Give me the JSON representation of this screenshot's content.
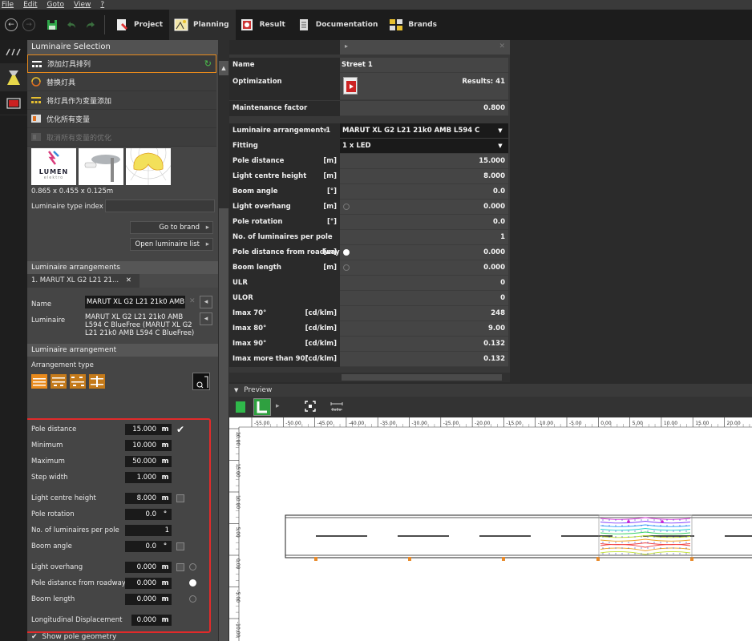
{
  "menu": [
    "File",
    "Edit",
    "Goto",
    "View",
    "?"
  ],
  "toolbar": {
    "tabs": [
      {
        "label": "Project",
        "active": false
      },
      {
        "label": "Planning",
        "active": true
      },
      {
        "label": "Result",
        "active": false
      },
      {
        "label": "Documentation",
        "active": false
      },
      {
        "label": "Brands",
        "active": false
      }
    ]
  },
  "left": {
    "selection_title": "Luminaire Selection",
    "menu_items": [
      "添加灯具排列",
      "替换灯具",
      "将灯具作为变量添加",
      "优化所有变量",
      "取消所有变量的优化"
    ],
    "brand_logo": "LUMEN",
    "brand_sub": "elektro",
    "dimensions": "0.865 x 0.455 x 0.125m",
    "type_index_label": "Luminaire type index",
    "type_index_value": "",
    "go_to_brand": "Go to brand",
    "open_list": "Open luminaire list",
    "arrangements_title": "Luminaire arrangements",
    "arrangement_tab": "1. MARUT XL G2 L21 21...",
    "name_label": "Name",
    "name_value": "MARUT XL G2 L21 21k0 AMB",
    "luminaire_label": "Luminaire",
    "luminaire_value": "MARUT XL G2 L21 21k0 AMB L594 C BlueFree (MARUT XL G2 L21 21k0 AMB L594 C BlueFree)",
    "arrangement_title": "Luminaire arrangement",
    "arrangement_type": "Arrangement type",
    "fields": {
      "pole_distance": {
        "label": "Pole distance",
        "value": "15.000",
        "unit": "m"
      },
      "minimum": {
        "label": "Minimum",
        "value": "10.000",
        "unit": "m"
      },
      "maximum": {
        "label": "Maximum",
        "value": "50.000",
        "unit": "m"
      },
      "step": {
        "label": "Step width",
        "value": "1.000",
        "unit": "m"
      },
      "lch": {
        "label": "Light centre height",
        "value": "8.000",
        "unit": "m"
      },
      "rot": {
        "label": "Pole rotation",
        "value": "0.0",
        "unit": "°"
      },
      "num": {
        "label": "No. of luminaires per pole",
        "value": "1"
      },
      "boom_angle": {
        "label": "Boom angle",
        "value": "0.0",
        "unit": "°"
      },
      "overhang": {
        "label": "Light overhang",
        "value": "0.000",
        "unit": "m"
      },
      "pdr": {
        "label": "Pole distance from roadway",
        "value": "0.000",
        "unit": "m"
      },
      "boom_len": {
        "label": "Boom length",
        "value": "0.000",
        "unit": "m"
      },
      "long": {
        "label": "Longitudinal Displacement",
        "value": "0.000",
        "unit": "m"
      }
    },
    "show_geom": "Show pole geometry"
  },
  "grid": {
    "header_name": "Name",
    "header_value": "Street 1",
    "optimization": "Optimization",
    "results": "Results: 41",
    "rows": [
      {
        "label": "Maintenance factor",
        "unit": "",
        "value": "0.800"
      },
      {
        "label": "Luminaire arrangement 1",
        "unit": "",
        "value": "MARUT XL G2 L21 21k0 AMB L594 C BlueFree"
      },
      {
        "label": "Fitting",
        "unit": "",
        "value": "1 x LED"
      },
      {
        "label": "Pole distance",
        "unit": "[m]",
        "value": "15.000"
      },
      {
        "label": "Light centre height",
        "unit": "[m]",
        "value": "8.000"
      },
      {
        "label": "Boom angle",
        "unit": "[°]",
        "value": "0.0"
      },
      {
        "label": "Light overhang",
        "unit": "[m]",
        "value": "0.000"
      },
      {
        "label": "Pole rotation",
        "unit": "[°]",
        "value": "0.0"
      },
      {
        "label": "No. of luminaires per pole",
        "unit": "",
        "value": "1"
      },
      {
        "label": "Pole distance from roadway",
        "unit": "[m]",
        "value": "0.000"
      },
      {
        "label": "Boom length",
        "unit": "[m]",
        "value": "0.000"
      },
      {
        "label": "ULR",
        "unit": "",
        "value": "0"
      },
      {
        "label": "ULOR",
        "unit": "",
        "value": "0"
      },
      {
        "label": "Imax 70°",
        "unit": "[cd/klm]",
        "value": "248"
      },
      {
        "label": "Imax 80°",
        "unit": "[cd/klm]",
        "value": "9.00"
      },
      {
        "label": "Imax 90°",
        "unit": "[cd/klm]",
        "value": "0.132"
      },
      {
        "label": "Imax more than 90°",
        "unit": "[cd/klm]",
        "value": "0.132"
      }
    ]
  },
  "preview": {
    "title": "Preview",
    "ruler_h": [
      "-55.00",
      "-50.00",
      "-45.00",
      "-40.00",
      "-35.00",
      "-30.00",
      "-25.00",
      "-20.00",
      "-15.00",
      "-10.00",
      "-5.00",
      "0.00",
      "5.00",
      "10.00",
      "15.00",
      "20.00"
    ],
    "ruler_v": [
      "20.00",
      "15.00",
      "10.00",
      "5.00",
      "0.00",
      "-5.00",
      "-10.00"
    ]
  }
}
